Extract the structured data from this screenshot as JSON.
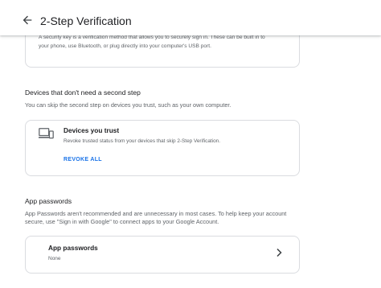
{
  "header": {
    "back_icon": "arrow-back-icon",
    "title": "2-Step Verification"
  },
  "security_key": {
    "description": "A security key is a verification method that allows you to securely sign in. These can be built in to your phone, use Bluetooth, or plug directly into your computer's USB port."
  },
  "devices_section": {
    "title": "Devices that don't need a second step",
    "description": "You can skip the second step on devices you trust, such as your own computer.",
    "card": {
      "icon": "devices-icon",
      "title": "Devices you trust",
      "subtitle": "Revoke trusted status from your devices that skip 2-Step Verification.",
      "action": "REVOKE ALL"
    }
  },
  "app_passwords_section": {
    "title": "App passwords",
    "description": "App Passwords aren't recommended and are unnecessary in most cases. To help keep your account secure, use \"Sign in with Google\" to connect apps to your Google Account.",
    "card": {
      "title": "App passwords",
      "status": "None",
      "icon": "chevron-right-icon"
    }
  },
  "colors": {
    "accent": "#1a73e8",
    "text_primary": "#202124",
    "text_secondary": "#5f6368",
    "border": "#dadce0"
  }
}
